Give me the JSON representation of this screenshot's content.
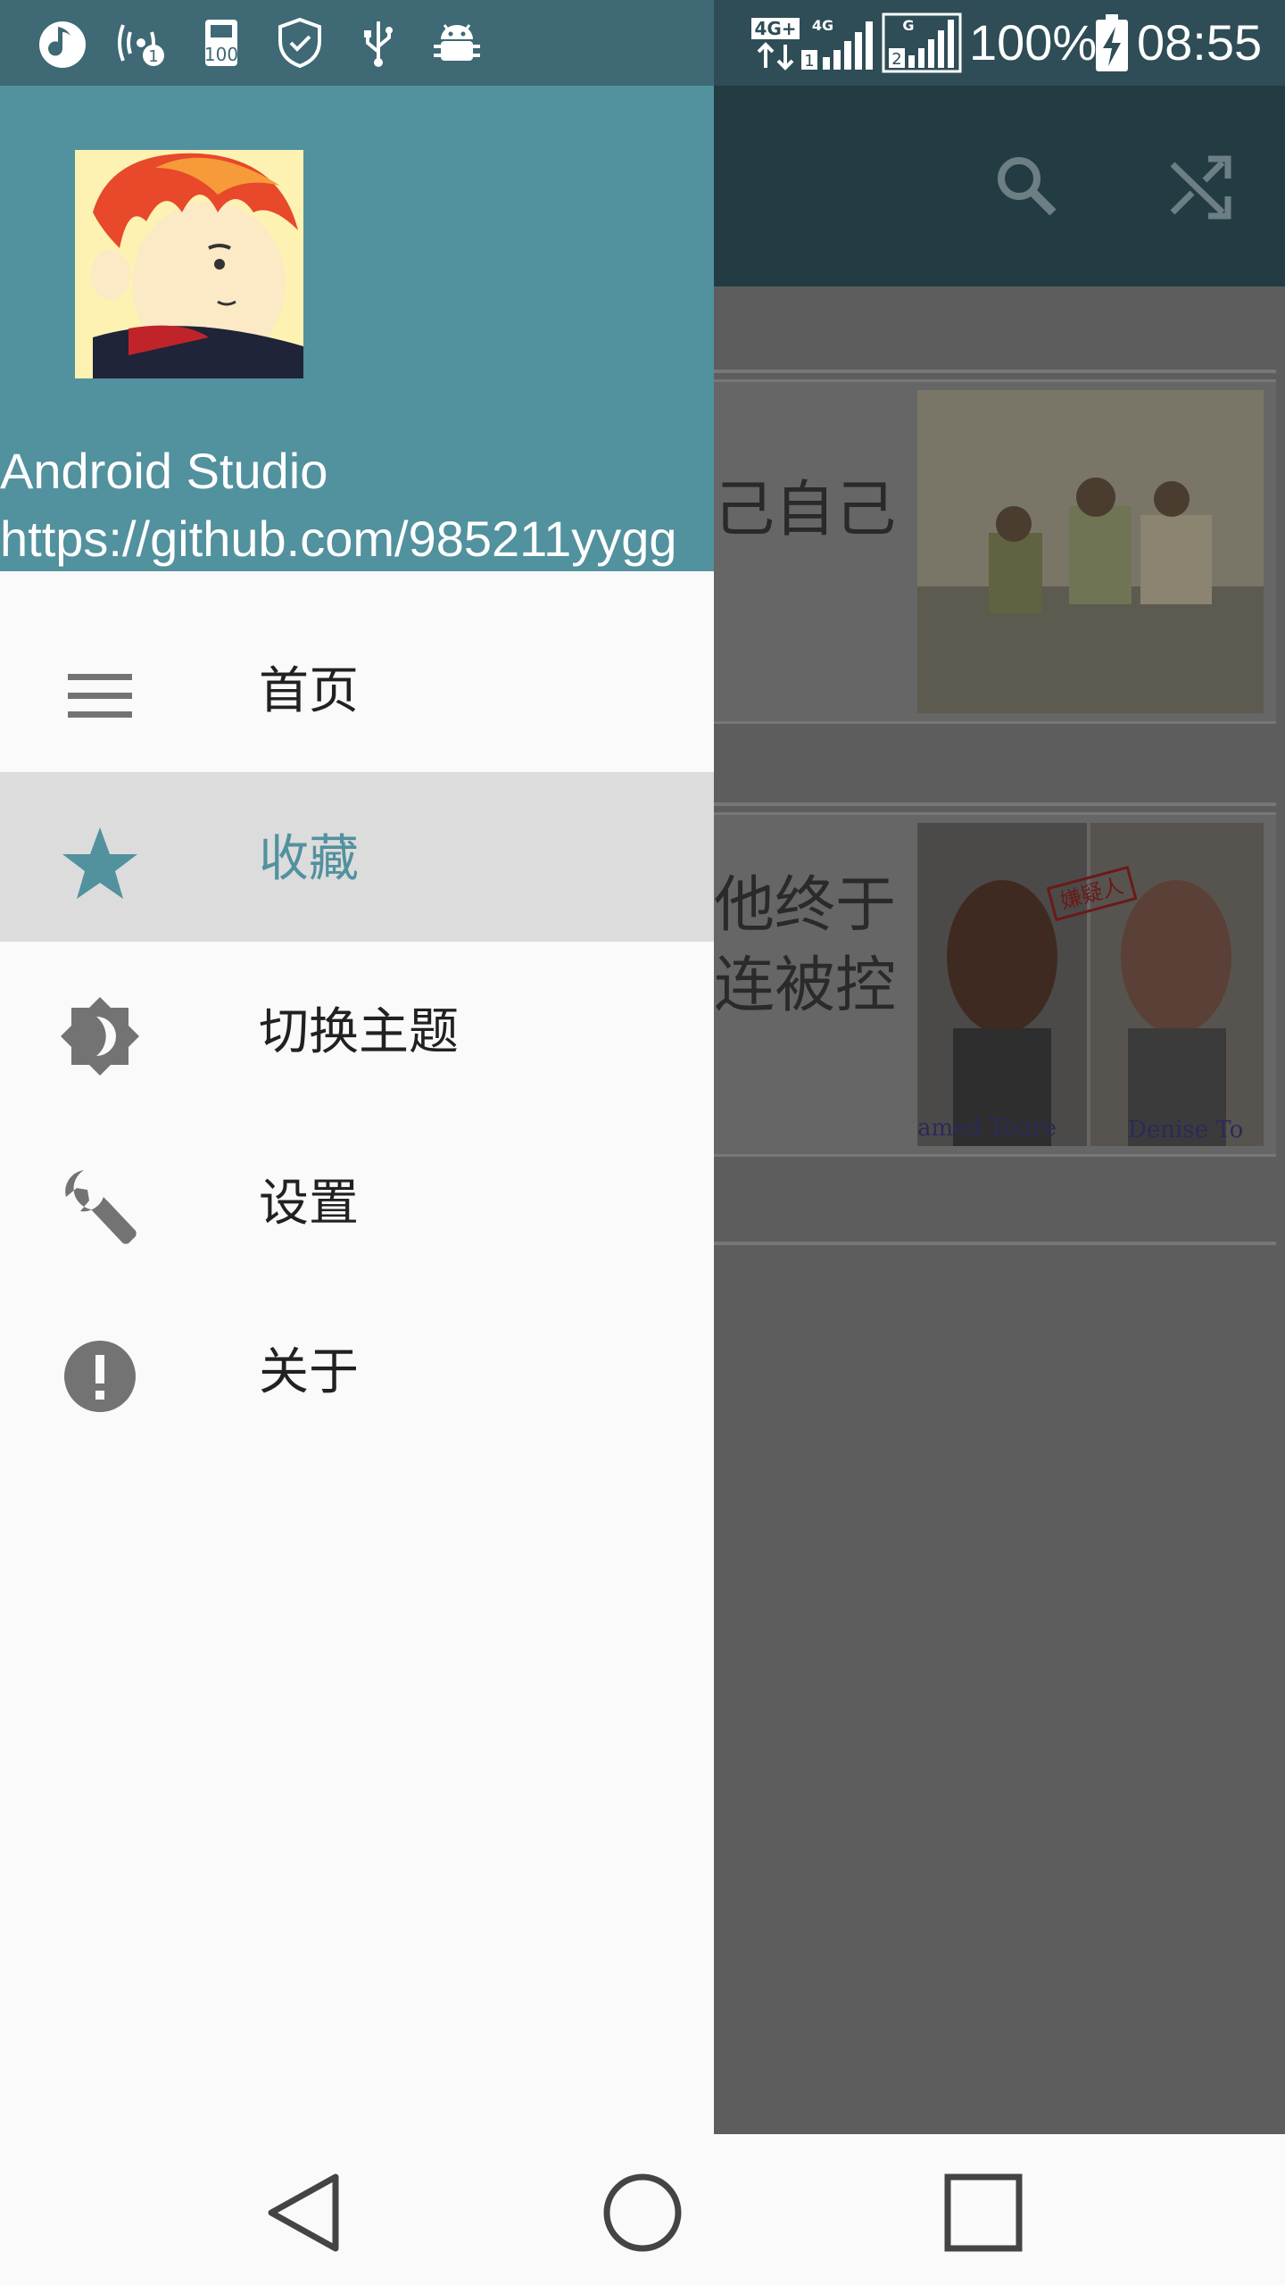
{
  "status_bar": {
    "battery_percent": "100%",
    "time": "08:55",
    "network_1": "4G+",
    "network_2": "4G",
    "network_3": "G",
    "sim_1": "1",
    "sim_2": "2",
    "left_icons": [
      "music-icon",
      "wifi-hotspot-icon",
      "storage-100-icon",
      "shield-icon",
      "usb-icon",
      "android-debug-icon"
    ]
  },
  "app": {
    "toolbar_actions": [
      "search-icon",
      "shuffle-icon"
    ],
    "cards": [
      {
        "text_line1": "己自己",
        "text_line2": ""
      },
      {
        "text_line1": "他终于",
        "text_line2": "连被控"
      }
    ],
    "photo_caption_1": "amed Toure",
    "photo_caption_2": "Denise To",
    "stamp_text": "嫌疑人"
  },
  "drawer": {
    "account_name": "Android Studio",
    "account_url": "https://github.com/985211yygg",
    "menu": [
      {
        "label": "首页",
        "icon": "menu-icon"
      },
      {
        "label": "收藏",
        "icon": "star-icon",
        "selected": true
      },
      {
        "label": "切换主题",
        "icon": "brightness-icon"
      },
      {
        "label": "设置",
        "icon": "wrench-icon"
      },
      {
        "label": "关于",
        "icon": "info-icon"
      }
    ]
  },
  "colors": {
    "primary": "#52919e",
    "status_bar": "#3e6975",
    "toolbar_dimmed": "#233c44",
    "selected_row": "#dcdcdc"
  },
  "nav_bar": [
    "back-button",
    "home-button",
    "recents-button"
  ]
}
